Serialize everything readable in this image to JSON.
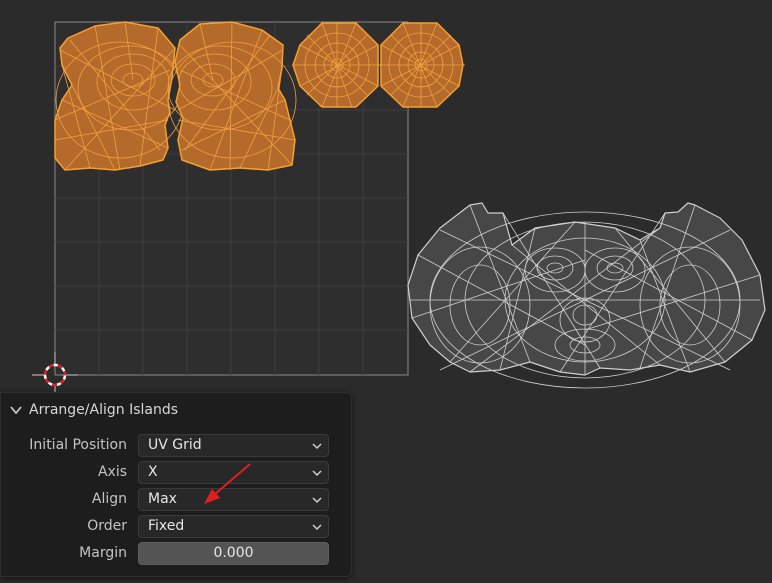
{
  "panel": {
    "title": "Arrange/Align Islands",
    "fields": [
      {
        "label": "Initial Position",
        "value": "UV Grid",
        "kind": "dropdown"
      },
      {
        "label": "Axis",
        "value": "X",
        "kind": "dropdown"
      },
      {
        "label": "Align",
        "value": "Max",
        "kind": "dropdown"
      },
      {
        "label": "Order",
        "value": "Fixed",
        "kind": "dropdown"
      },
      {
        "label": "Margin",
        "value": "0.000",
        "kind": "number"
      }
    ]
  },
  "colors": {
    "background": "#2b2b2b",
    "selected_island_fill": "#b46a2a",
    "selected_island_edge": "#f6a030",
    "unselected_mesh_fill": "#474747",
    "unselected_mesh_edge": "#cfcfcf",
    "annotation_arrow": "#e02020"
  },
  "icons": [
    "collapse-chevron-icon",
    "dropdown-arrow-icon",
    "2d-cursor-icon"
  ]
}
